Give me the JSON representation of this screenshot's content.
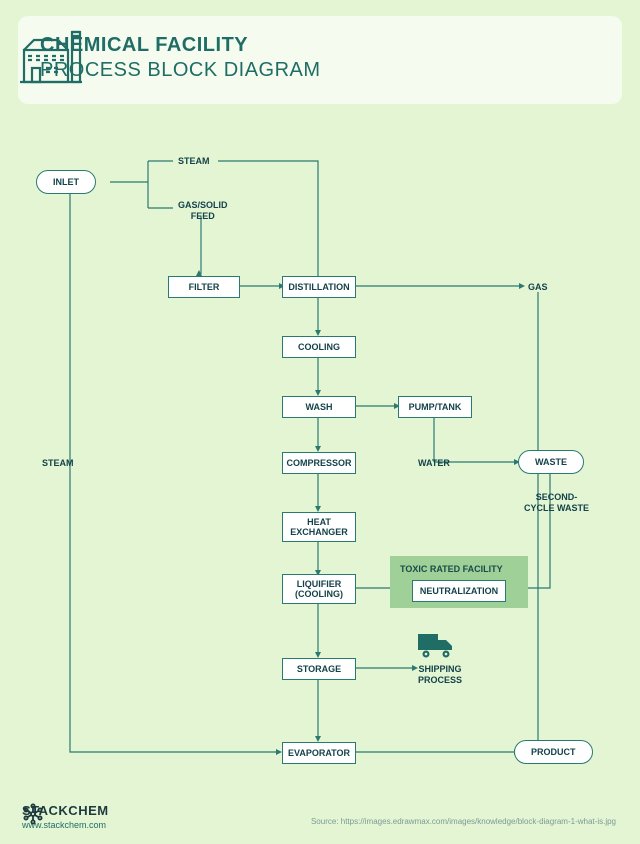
{
  "header": {
    "title1": "CHEMICAL FACILITY",
    "title2": "PROCESS BLOCK DIAGRAM"
  },
  "nodes": {
    "inlet": "INLET",
    "filter": "FILTER",
    "distillation": "DISTILLATION",
    "cooling": "COOLING",
    "wash": "WASH",
    "pumptank": "PUMP/TANK",
    "compressor": "COMPRESSOR",
    "waste": "WASTE",
    "heatex": "HEAT EXCHANGER",
    "liquifier": "LIQUIFIER (COOLING)",
    "neutralization": "NEUTRALIZATION",
    "storage": "STORAGE",
    "evaporator": "EVAPORATOR",
    "product": "PRODUCT"
  },
  "labels": {
    "steam_top": "STEAM",
    "gas_solid": "GAS/SOLID\nFEED",
    "gas": "GAS",
    "steam_left": "STEAM",
    "water": "WATER",
    "second_cycle": "SECOND-\nCYCLE WASTE",
    "toxic": "TOXIC RATED FACILITY",
    "shipping": "SHIPPING\nPROCESS"
  },
  "footer": {
    "brand": "STACKCHEM",
    "url": "www.stackchem.com",
    "source": "Source: https://images.edrawmax.com/images/knowledge/block-diagram-1-what-is.jpg"
  }
}
